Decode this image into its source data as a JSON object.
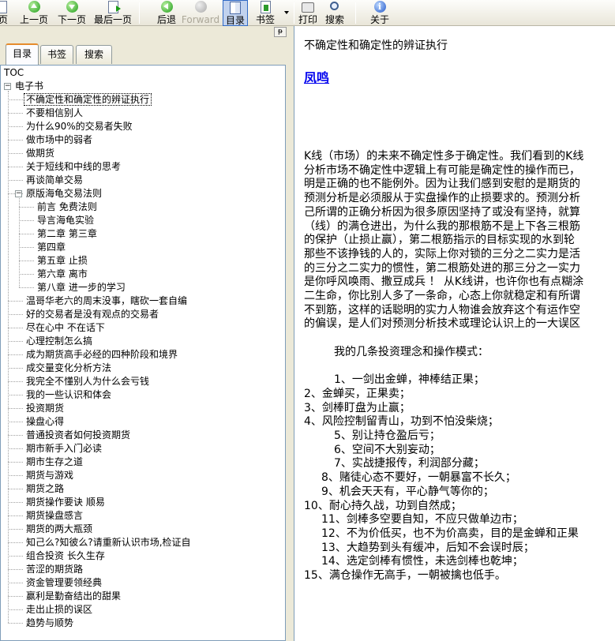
{
  "toolbar": {
    "buttons": [
      {
        "id": "home",
        "label": "页"
      },
      {
        "id": "prev",
        "label": "上一页"
      },
      {
        "id": "next",
        "label": "下一页"
      },
      {
        "id": "last",
        "label": "最后一页"
      },
      {
        "id": "back",
        "label": "后退"
      },
      {
        "id": "forward",
        "label": "Forward"
      },
      {
        "id": "toc",
        "label": "目录"
      },
      {
        "id": "bookmark",
        "label": "书签"
      },
      {
        "id": "print",
        "label": "打印"
      },
      {
        "id": "search",
        "label": "搜索"
      },
      {
        "id": "about",
        "label": "关于"
      }
    ]
  },
  "panel": {
    "pin_label": "ᵽ",
    "tabs": [
      {
        "label": "目录",
        "active": true
      },
      {
        "label": "书签",
        "active": false
      },
      {
        "label": "搜索",
        "active": false
      }
    ]
  },
  "tree": {
    "root": "TOC",
    "book": "电子书",
    "items": [
      {
        "label": "不确定性和确定性的辨证执行",
        "level": 1,
        "selected": true
      },
      {
        "label": "不要相信别人",
        "level": 1
      },
      {
        "label": "为什么90%的交易者失败",
        "level": 1
      },
      {
        "label": "做市场中的弱者",
        "level": 1
      },
      {
        "label": "做期货",
        "level": 1
      },
      {
        "label": "关于短线和中线的思考",
        "level": 1
      },
      {
        "label": "再谈简单交易",
        "level": 1
      },
      {
        "label": "原版海龟交易法则",
        "level": 1,
        "expanded": true
      },
      {
        "label": "前言 免费法则",
        "level": 2
      },
      {
        "label": "导言海龟实验",
        "level": 2
      },
      {
        "label": "第二章 第三章",
        "level": 2
      },
      {
        "label": "第四章",
        "level": 2
      },
      {
        "label": "第五章 止损",
        "level": 2
      },
      {
        "label": "第六章 离市",
        "level": 2
      },
      {
        "label": "第八章 进一步的学习",
        "level": 2
      },
      {
        "label": "温哥华老六的周末没事，瞎砍一套自编",
        "level": 1
      },
      {
        "label": "好的交易者是没有观点的交易者",
        "level": 1
      },
      {
        "label": "尽在心中 不在话下",
        "level": 1
      },
      {
        "label": "心理控制怎么搞",
        "level": 1
      },
      {
        "label": "成为期货高手必经的四种阶段和境界",
        "level": 1
      },
      {
        "label": "成交量变化分析方法",
        "level": 1
      },
      {
        "label": "我完全不懂别人为什么会亏钱",
        "level": 1
      },
      {
        "label": "我的一些认识和体会",
        "level": 1
      },
      {
        "label": "投资期货",
        "level": 1
      },
      {
        "label": "操盘心得",
        "level": 1
      },
      {
        "label": "普通投资者如何投资期货",
        "level": 1
      },
      {
        "label": "期市新手入门必读",
        "level": 1
      },
      {
        "label": "期市生存之道",
        "level": 1
      },
      {
        "label": "期货与游戏",
        "level": 1
      },
      {
        "label": "期货之路",
        "level": 1
      },
      {
        "label": "期货操作要诀 顺易",
        "level": 1
      },
      {
        "label": "期货操盘感言",
        "level": 1
      },
      {
        "label": "期货的两大瓶颈",
        "level": 1
      },
      {
        "label": "知己么?知彼么?请重新认识市场,检证自",
        "level": 1
      },
      {
        "label": "组合投资 长久生存",
        "level": 1
      },
      {
        "label": "苦涩的期货路",
        "level": 1
      },
      {
        "label": "资金管理要领经典",
        "level": 1
      },
      {
        "label": "赢利是勤奋结出的甜果",
        "level": 1
      },
      {
        "label": "走出止损的误区",
        "level": 1
      },
      {
        "label": "趋势与顺势",
        "level": 1
      }
    ]
  },
  "content": {
    "title": "不确定性和确定性的辨证执行",
    "author": "凤鸣",
    "lines": [
      {
        "text": "K线（市场）的未来不确定性多于确定性。我们看到的K线",
        "indent": 0
      },
      {
        "text": "分析市场不确定性中逻辑上有可能是确定性的操作而已，",
        "indent": 0
      },
      {
        "text": "明是正确的也不能例外。因为让我们感到安慰的是期货的",
        "indent": 0
      },
      {
        "text": "预测分析是必须服从于实盘操作的止损要求的。预测分析",
        "indent": 0
      },
      {
        "text": "己所谓的正确分析因为很多原因坚持了或没有坚持，就算",
        "indent": 0
      },
      {
        "text": "（线）的满仓进出，为什么我的那根筋不是上下各三根筋",
        "indent": 0
      },
      {
        "text": "的保护（止损止赢），第二根筋指示的目标实现的水到轮",
        "indent": 0
      },
      {
        "text": "那些不该挣钱的人的，实际上你对锁的三分之二实力是活",
        "indent": 0
      },
      {
        "text": "的三分之二实力的惯性，第二根筋处进的那三分之一实力",
        "indent": 0
      },
      {
        "text": "是你呼风唤雨、撒豆成兵 ！ 从K线讲，也许你也有点糊涂",
        "indent": 0
      },
      {
        "text": "二生命，你比别人多了一条命，心态上你就稳定和有所谓",
        "indent": 0
      },
      {
        "text": "不到筋，这样的话聪明的实力人物谁会放弃这个有运作空",
        "indent": 0
      },
      {
        "text": "的偏误，是人们对预测分析技术或理论认识上的一大误区",
        "indent": 0
      },
      {
        "text": "",
        "indent": 0
      },
      {
        "text": "我的几条投资理念和操作模式：",
        "indent": 38
      },
      {
        "text": "",
        "indent": 0
      },
      {
        "text": "1、一剑出金蝉，神棒结正果；",
        "indent": 38
      },
      {
        "text": "2、金蝉买，正果卖；",
        "indent": 0
      },
      {
        "text": "3、剑棒盯盘为止赢；",
        "indent": 0
      },
      {
        "text": "4、风险控制留青山，功到不怕没柴烧；",
        "indent": 0
      },
      {
        "text": "5、别让持仓盈后亏；",
        "indent": 38
      },
      {
        "text": "6、空间不大别妄动；",
        "indent": 38
      },
      {
        "text": "7、实战捷报传，利润部分藏；",
        "indent": 38
      },
      {
        "text": "8、赌徒心态不要好，一朝暴富不长久；",
        "indent": 22
      },
      {
        "text": "9、机会天天有，平心静气等你的；",
        "indent": 22
      },
      {
        "text": "10、耐心持久战，功到自然成；",
        "indent": 0
      },
      {
        "text": "11、剑棒多空要自知，不应只做单边市；",
        "indent": 22
      },
      {
        "text": "12、不为价低买，也不为价高卖，目的是金蝉和正果",
        "indent": 22
      },
      {
        "text": "13、大趋势到头有缓冲，后知不会误时辰；",
        "indent": 22
      },
      {
        "text": "14、选定剑棒有惯性，未选剑棒也乾坤；",
        "indent": 22
      },
      {
        "text": "15、满仓操作无高手，一朝被擒也低手。",
        "indent": 0
      }
    ]
  }
}
